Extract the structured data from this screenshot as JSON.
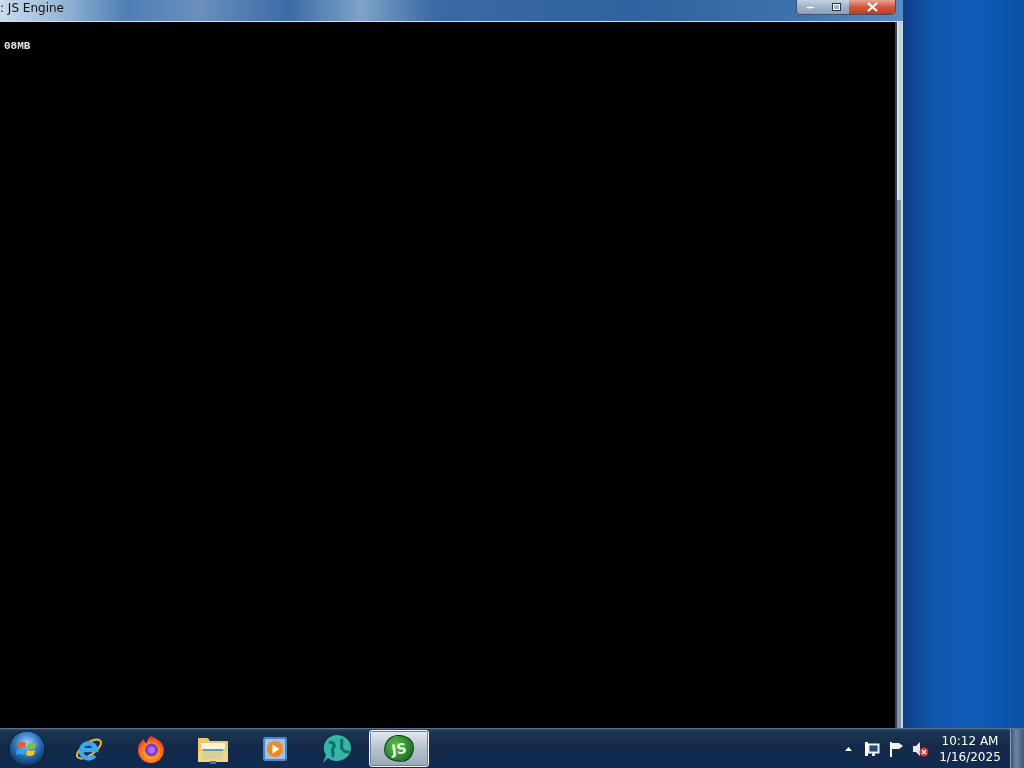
{
  "window": {
    "title": ": JS Engine",
    "console_lines": [
      "08MB"
    ]
  },
  "taskbar": {
    "apps": [
      {
        "kind": "ie",
        "selected": false
      },
      {
        "kind": "firefox",
        "selected": false
      },
      {
        "kind": "folder",
        "selected": false
      },
      {
        "kind": "media",
        "selected": false
      },
      {
        "kind": "globe",
        "selected": false
      },
      {
        "kind": "script",
        "label": "JS",
        "selected": true
      }
    ],
    "tray": {
      "sound": {
        "muted": true
      },
      "clock": {
        "time": "10:12 AM",
        "date": "1/16/2025"
      }
    }
  }
}
